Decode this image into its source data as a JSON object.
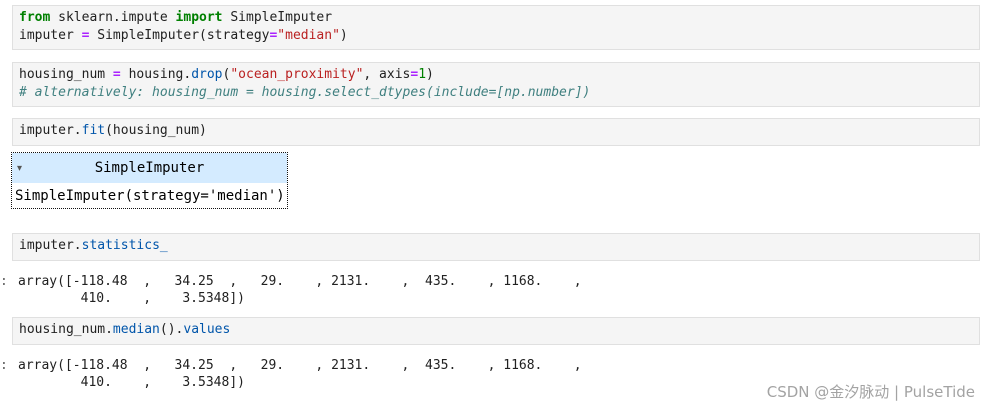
{
  "cells": [
    {
      "id": "cell-1",
      "line1_from": "from",
      "line1_mod": " sklearn.impute ",
      "line1_import": "import",
      "line1_name": " SimpleImputer",
      "line2_var": "imputer ",
      "line2_eq": "=",
      "line2_call": " SimpleImputer(strategy",
      "line2_eq2": "=",
      "line2_str": "\"median\"",
      "line2_close": ")"
    },
    {
      "id": "cell-2",
      "line1_var": "housing_num ",
      "line1_eq": "=",
      "line1_obj": " housing.",
      "line1_method": "drop",
      "line1_paren": "(",
      "line1_str": "\"ocean_proximity\"",
      "line1_arg": ", axis",
      "line1_eq2": "=",
      "line1_num": "1",
      "line1_close": ")",
      "line2_comment": "# alternatively: housing_num = housing.select_dtypes(include=[np.number])"
    },
    {
      "id": "cell-3",
      "obj": "imputer.",
      "method": "fit",
      "args": "(housing_num)"
    },
    {
      "id": "cell-4",
      "obj": "imputer.",
      "attr": "statistics_"
    },
    {
      "id": "cell-5",
      "obj": "housing_num.",
      "method": "median",
      "mid": "().",
      "attr": "values"
    }
  ],
  "widget": {
    "toggle_glyph": "▾",
    "title": "SimpleImputer",
    "repr": "SimpleImputer(strategy='median')"
  },
  "outputs": {
    "statistics_line1": "array([-118.48  ,   34.25  ,   29.    , 2131.    ,  435.    , 1168.    ,",
    "statistics_line2": "        410.    ,    3.5348])",
    "median_line1": "array([-118.48  ,   34.25  ,   29.    , 2131.    ,  435.    , 1168.    ,",
    "median_line2": "        410.    ,    3.5348])",
    "prompt_colon": ":"
  },
  "watermark": "CSDN @金汐脉动 | PulseTide",
  "colors": {
    "keyword": "#008000",
    "string": "#ba2121",
    "comment": "#408080",
    "attribute": "#0055aa",
    "widget_header": "#d4ebff",
    "cell_background": "#f5f5f5"
  }
}
